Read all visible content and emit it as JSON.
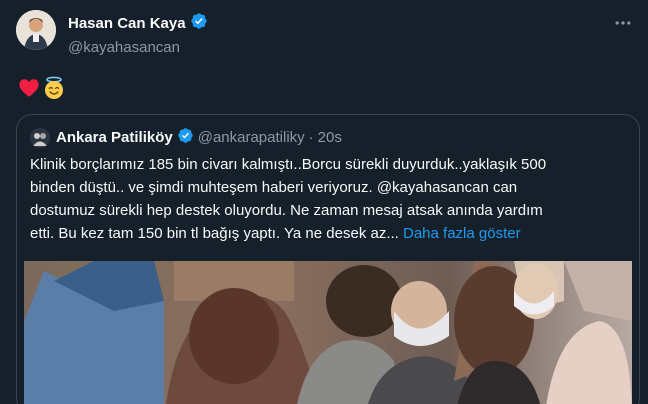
{
  "tweet": {
    "display_name": "Hasan Can Kaya",
    "handle": "@kayahasancan",
    "emojis": [
      "red-heart",
      "smiling-face-with-halo"
    ]
  },
  "quoted": {
    "display_name": "Ankara Patiliköy",
    "handle": "@ankarapatiliky",
    "separator": "·",
    "time": "20s",
    "text_lines": [
      "Klinik borçlarımız 185 bin civarı kalmıştı..Borcu sürekli duyurduk..yaklaşık 500",
      "binden düştü.. ve şimdi muhteşem haberi veriyoruz. @kayahasancan can",
      "dostumuz sürekli hep destek oluyordu. Ne zaman mesaj atsak anında yardım",
      "etti. Bu kez tam 150 bin tl bağış yaptı. Ya ne desek az..."
    ],
    "show_more": "Daha fazla göster"
  },
  "colors": {
    "background": "#15202b",
    "text": "#f7f9f9",
    "secondary": "#8b98a5",
    "accent": "#1d9bf0",
    "border": "#38444d"
  },
  "icons": {
    "more": "more-horizontal-icon",
    "verified": "verified-badge-icon"
  }
}
